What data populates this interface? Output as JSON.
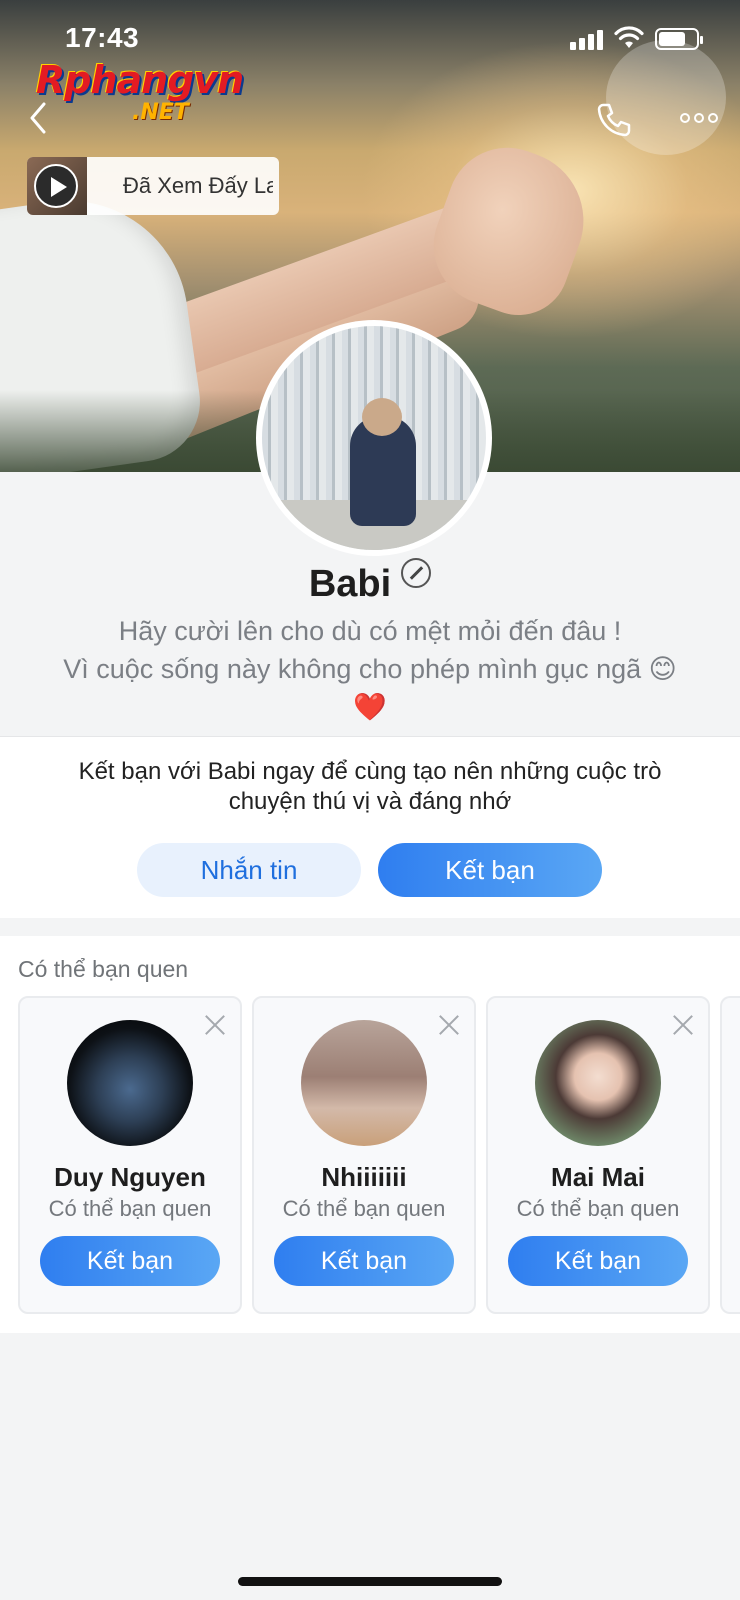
{
  "status_bar": {
    "time": "17:43"
  },
  "watermark": {
    "main": "Rphangvn",
    "suffix": ".NET"
  },
  "nav": {
    "back_icon": "chevron-left-icon",
    "call_icon": "phone-icon",
    "more_icon": "more-horizontal-icon"
  },
  "music": {
    "label": "Đã Xem Đấy La"
  },
  "profile": {
    "name": "Babi",
    "bio_line1": "Hãy cười lên cho dù có mệt mỏi đến đâu !",
    "bio_line2": "Vì cuộc sống này không cho phép mình gục ngã 😊",
    "bio_line3": "❤️"
  },
  "prompt": {
    "text": "Kết bạn với Babi ngay để cùng tạo nên những cuộc trò chuyện thú vị và đáng nhớ",
    "message_button": "Nhắn tin",
    "add_button": "Kết bạn"
  },
  "suggestions": {
    "title": "Có thể bạn quen",
    "items": [
      {
        "name": "Duy Nguyen",
        "subtitle": "Có thể bạn quen",
        "button": "Kết bạn"
      },
      {
        "name": "Nhiiiiiii",
        "subtitle": "Có thể bạn quen",
        "button": "Kết bạn"
      },
      {
        "name": "Mai Mai",
        "subtitle": "Có thể bạn quen",
        "button": "Kết bạn"
      }
    ]
  },
  "colors": {
    "accent": "#2f7ef0",
    "accent_light": "#e8f1fd",
    "background": "#f3f4f5"
  }
}
